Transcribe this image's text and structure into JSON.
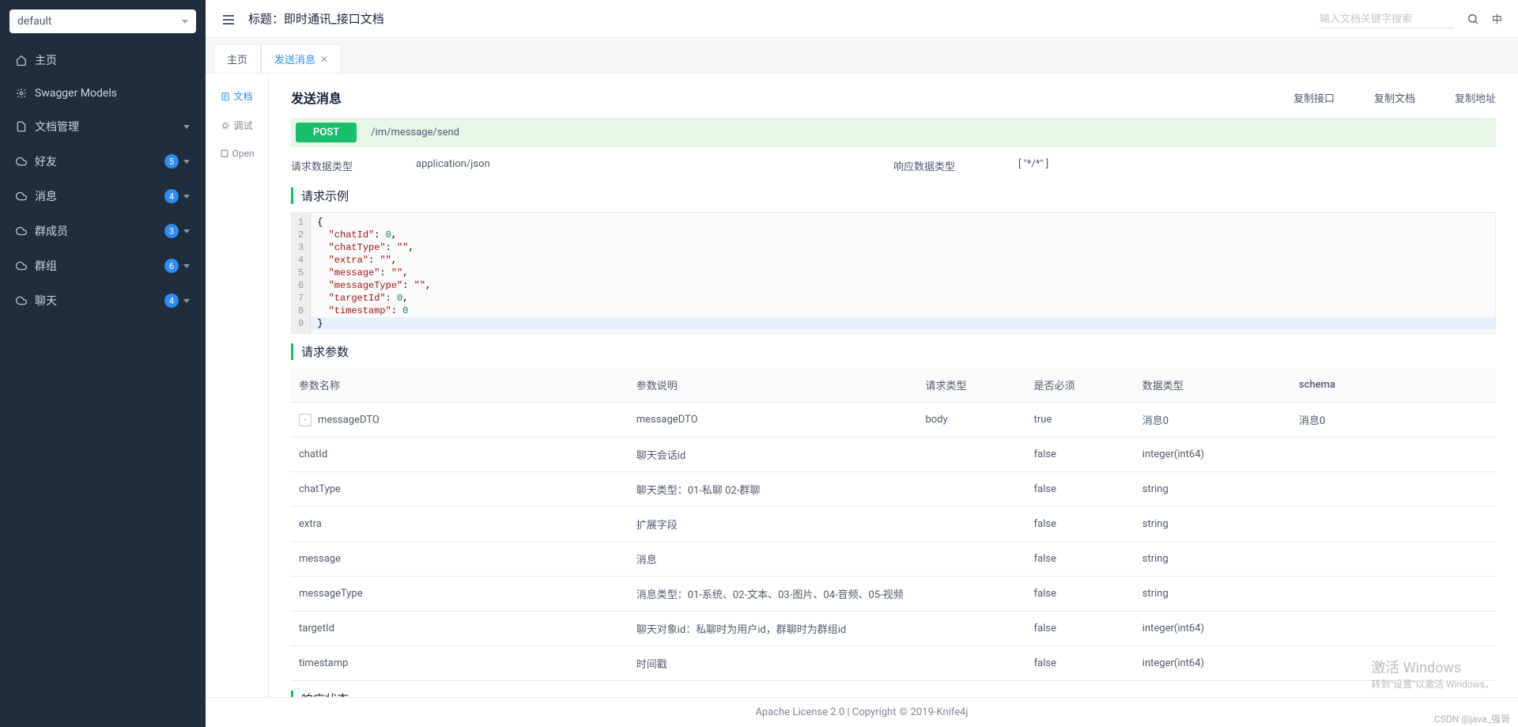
{
  "sidebar": {
    "project_selected": "default",
    "home": "主页",
    "swagger_models": "Swagger Models",
    "doc_mgmt": "文档管理",
    "groups": [
      {
        "label": "好友",
        "count": "5"
      },
      {
        "label": "消息",
        "count": "4"
      },
      {
        "label": "群成员",
        "count": "3"
      },
      {
        "label": "群组",
        "count": "6"
      },
      {
        "label": "聊天",
        "count": "4"
      }
    ]
  },
  "topbar": {
    "title_prefix": "标题：",
    "title": "即时通讯_接口文档",
    "search_placeholder": "输入文档关键字搜索",
    "lang": "中"
  },
  "tabs": {
    "home": "主页",
    "active": "发送消息"
  },
  "inner_nav": {
    "doc": "文档",
    "debug": "调试",
    "open": "Open"
  },
  "doc": {
    "title": "发送消息",
    "actions": {
      "copy_api": "复制接口",
      "copy_doc": "复制文档",
      "copy_url": "复制地址"
    },
    "method": "POST",
    "path": "/im/message/send",
    "req_type_label": "请求数据类型",
    "req_type_value": "application/json",
    "res_type_label": "响应数据类型",
    "res_type_value": "[ \"*/*\" ]",
    "example_title": "请求示例",
    "params_title": "请求参数",
    "response_title": "响应状态",
    "code": {
      "l1": "{",
      "l2a": "\"chatId\"",
      "l2b": ": ",
      "l2c": "0",
      "l2d": ",",
      "l3a": "\"chatType\"",
      "l3b": ": ",
      "l3c": "\"\"",
      "l3d": ",",
      "l4a": "\"extra\"",
      "l4b": ": ",
      "l4c": "\"\"",
      "l4d": ",",
      "l5a": "\"message\"",
      "l5b": ": ",
      "l5c": "\"\"",
      "l5d": ",",
      "l6a": "\"messageType\"",
      "l6b": ": ",
      "l6c": "\"\"",
      "l6d": ",",
      "l7a": "\"targetId\"",
      "l7b": ": ",
      "l7c": "0",
      "l7d": ",",
      "l8a": "\"timestamp\"",
      "l8b": ": ",
      "l8c": "0",
      "l9": "}"
    },
    "thead": {
      "name": "参数名称",
      "desc": "参数说明",
      "reqtype": "请求类型",
      "required": "是否必须",
      "datatype": "数据类型",
      "schema": "schema"
    },
    "rows": [
      {
        "name": "messageDTO",
        "desc": "messageDTO",
        "reqtype": "body",
        "required": "true",
        "datatype": "消息0",
        "schema": "消息0",
        "root": true
      },
      {
        "name": "chatId",
        "desc": "聊天会话id",
        "reqtype": "",
        "required": "false",
        "datatype": "integer(int64)",
        "schema": ""
      },
      {
        "name": "chatType",
        "desc": "聊天类型：01-私聊 02-群聊",
        "reqtype": "",
        "required": "false",
        "datatype": "string",
        "schema": ""
      },
      {
        "name": "extra",
        "desc": "扩展字段",
        "reqtype": "",
        "required": "false",
        "datatype": "string",
        "schema": ""
      },
      {
        "name": "message",
        "desc": "消息",
        "reqtype": "",
        "required": "false",
        "datatype": "string",
        "schema": ""
      },
      {
        "name": "messageType",
        "desc": "消息类型：01-系统、02-文本、03-图片、04-音频、05-视频",
        "reqtype": "",
        "required": "false",
        "datatype": "string",
        "schema": ""
      },
      {
        "name": "targetId",
        "desc": "聊天对象id：私聊时为用户id，群聊时为群组id",
        "reqtype": "",
        "required": "false",
        "datatype": "integer(int64)",
        "schema": ""
      },
      {
        "name": "timestamp",
        "desc": "时间戳",
        "reqtype": "",
        "required": "false",
        "datatype": "integer(int64)",
        "schema": ""
      }
    ]
  },
  "footer": {
    "text_left": "Apache License 2.0 | Copyright ",
    "text_right": " 2019-Knife4j"
  },
  "watermark": {
    "line1": "激活 Windows",
    "line2": "转到\"设置\"以激活 Windows。"
  },
  "csdn": "CSDN @java_强哥"
}
